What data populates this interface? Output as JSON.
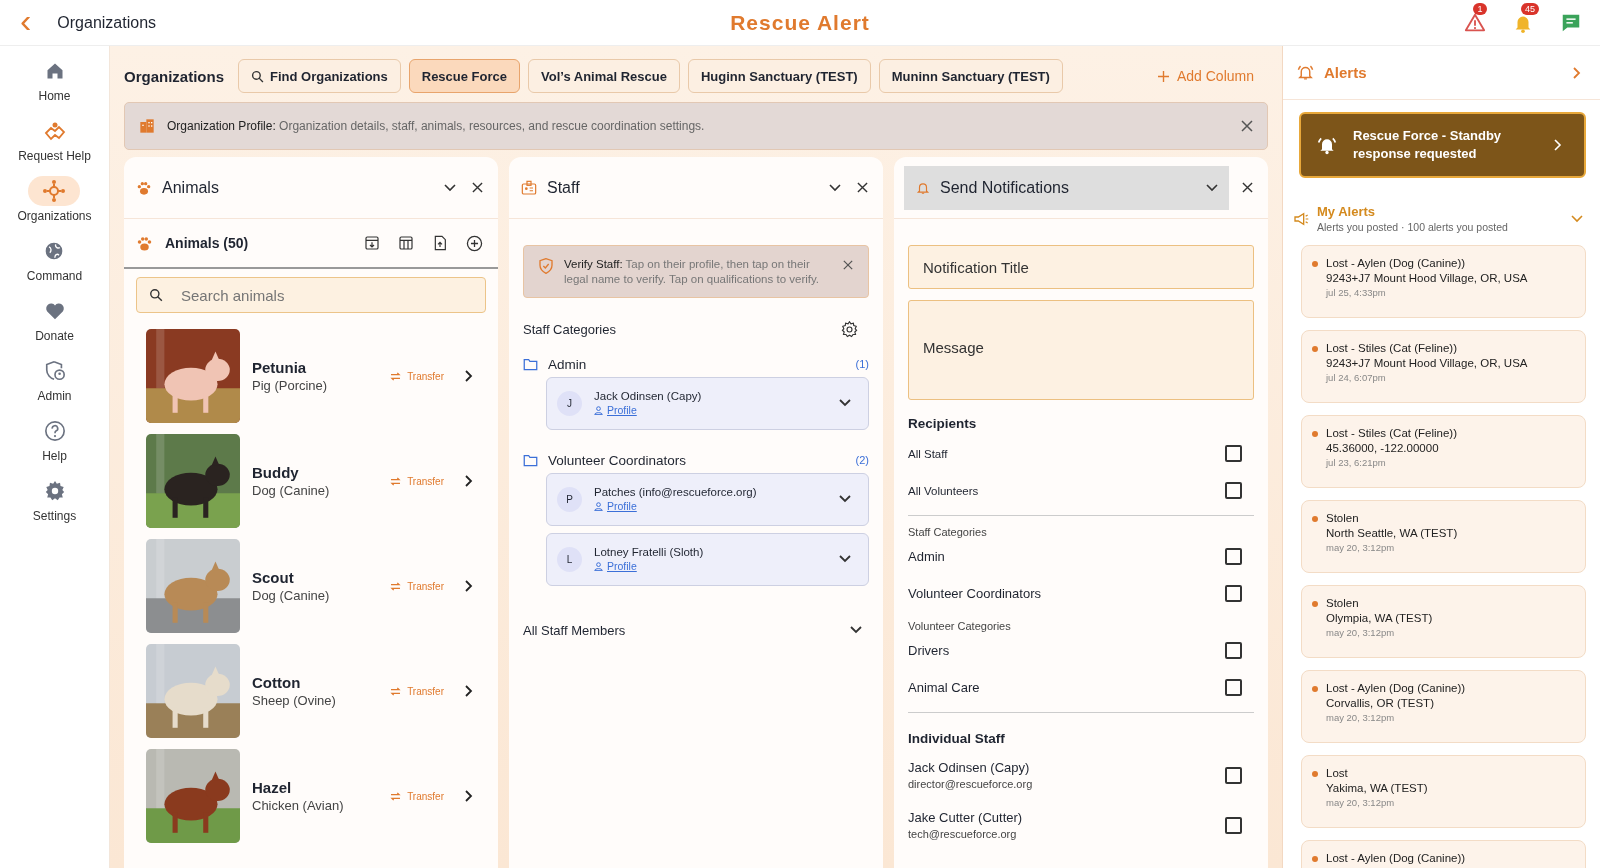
{
  "header": {
    "back": "‹",
    "title": "Organizations",
    "app_title": "Rescue Alert",
    "icons": [
      {
        "kind": "warning",
        "badge": "1"
      },
      {
        "kind": "bell",
        "badge": "45"
      },
      {
        "kind": "chat"
      }
    ]
  },
  "sidebar": {
    "items": [
      {
        "label": "Home",
        "kind": "home",
        "selected": false
      },
      {
        "label": "Request Help",
        "kind": "help-hand",
        "selected": false
      },
      {
        "label": "Organizations",
        "kind": "orgs",
        "selected": true
      },
      {
        "label": "Command",
        "kind": "globe",
        "selected": false
      },
      {
        "label": "Donate",
        "kind": "heart",
        "selected": false
      },
      {
        "label": "Admin",
        "kind": "shield",
        "selected": false
      },
      {
        "label": "Help",
        "kind": "question",
        "selected": false
      },
      {
        "label": "Settings",
        "kind": "gear",
        "selected": false
      }
    ]
  },
  "org_bar": {
    "title": "Organizations",
    "find": "Find Organizations",
    "add": "Add Column",
    "tabs": [
      {
        "label": "Rescue Force",
        "selected": true
      },
      {
        "label": "Vol’s Animal Rescue",
        "selected": false
      },
      {
        "label": "Huginn Sanctuary (TEST)",
        "selected": false
      },
      {
        "label": "Muninn Sanctuary (TEST)",
        "selected": false
      }
    ]
  },
  "banner": "**Organization Profile:** Organization details, staff, animals, resources, and rescue coordination settings.",
  "animals": {
    "title": "Animals",
    "list_title": "Animals (50)",
    "search_placeholder": "Search animals",
    "items": [
      {
        "name": "Petunia",
        "species": "Pig (Porcine)",
        "action": "Transfer"
      },
      {
        "name": "Buddy",
        "species": "Dog (Canine)",
        "action": "Transfer"
      },
      {
        "name": "Scout",
        "species": "Dog (Canine)",
        "action": "Transfer"
      },
      {
        "name": "Cotton",
        "species": "Sheep (Ovine)",
        "action": "Transfer"
      },
      {
        "name": "Hazel",
        "species": "Chicken (Avian)",
        "action": "Transfer"
      }
    ]
  },
  "staff": {
    "title": "Staff",
    "note": "**Verify Staff:** Tap on their profile, then tap on their legal name to verify. Tap on qualifications to verify.",
    "categories_title": "Staff Categories",
    "groups": [
      {
        "name": "Admin",
        "count": "(1)",
        "members": [
          {
            "initial": "J",
            "name": "Jack Odinsen (Capy)",
            "link": "Profile"
          }
        ]
      },
      {
        "name": "Volunteer Coordinators",
        "count": "(2)",
        "members": [
          {
            "initial": "P",
            "name": "Patches (info@rescueforce.org)",
            "link": "Profile"
          },
          {
            "initial": "L",
            "name": "Lotney Fratelli (Sloth)",
            "link": "Profile"
          }
        ]
      }
    ],
    "all_members": "All Staff Members"
  },
  "notifications": {
    "title": "Send Notifications",
    "title_placeholder": "Notification Title",
    "message_placeholder": "Message",
    "recipients_title": "Recipients",
    "recipients": [
      {
        "label": "All Staff",
        "checked": false
      },
      {
        "label": "All Volunteers",
        "checked": false
      }
    ],
    "staff_categories_title": "Staff Categories",
    "staff_categories": [
      {
        "label": "Admin",
        "checked": false
      },
      {
        "label": "Volunteer Coordinators",
        "checked": false
      }
    ],
    "volunteer_categories_title": "Volunteer Categories",
    "volunteer_categories": [
      {
        "label": "Drivers",
        "checked": false
      },
      {
        "label": "Animal Care",
        "checked": false
      }
    ],
    "individual_title": "Individual Staff",
    "individuals": [
      {
        "label": "Jack Odinsen (Capy)",
        "email": "director@rescueforce.org",
        "checked": false
      },
      {
        "label": "Jake Cutter (Cutter)",
        "email": "tech@rescueforce.org",
        "checked": false
      }
    ]
  },
  "alerts": {
    "title": "Alerts",
    "banner": "Rescue Force - Standby response requested",
    "my_title": "My Alerts",
    "my_sub": "Alerts you posted · 100 alerts you posted",
    "items": [
      {
        "title": "Lost - Aylen (Dog (Canine))",
        "location": "9243+J7 Mount Hood Village, OR, USA",
        "time": "jul 25, 4:33pm"
      },
      {
        "title": "Lost - Stiles (Cat (Feline))",
        "location": "9243+J7 Mount Hood Village, OR, USA",
        "time": "jul 24, 6:07pm"
      },
      {
        "title": "Lost - Stiles (Cat (Feline))",
        "location": "45.36000, -122.00000",
        "time": "jul 23, 6:21pm"
      },
      {
        "title": "Stolen",
        "location": "North Seattle, WA (TEST)",
        "time": "may 20, 3:12pm"
      },
      {
        "title": "Stolen",
        "location": "Olympia, WA (TEST)",
        "time": "may 20, 3:12pm"
      },
      {
        "title": "Lost - Aylen (Dog (Canine))",
        "location": "Corvallis, OR (TEST)",
        "time": "may 20, 3:12pm"
      },
      {
        "title": "Lost",
        "location": "Yakima, WA (TEST)",
        "time": "may 20, 3:12pm"
      },
      {
        "title": "Lost - Aylen (Dog (Canine))"
      }
    ]
  }
}
